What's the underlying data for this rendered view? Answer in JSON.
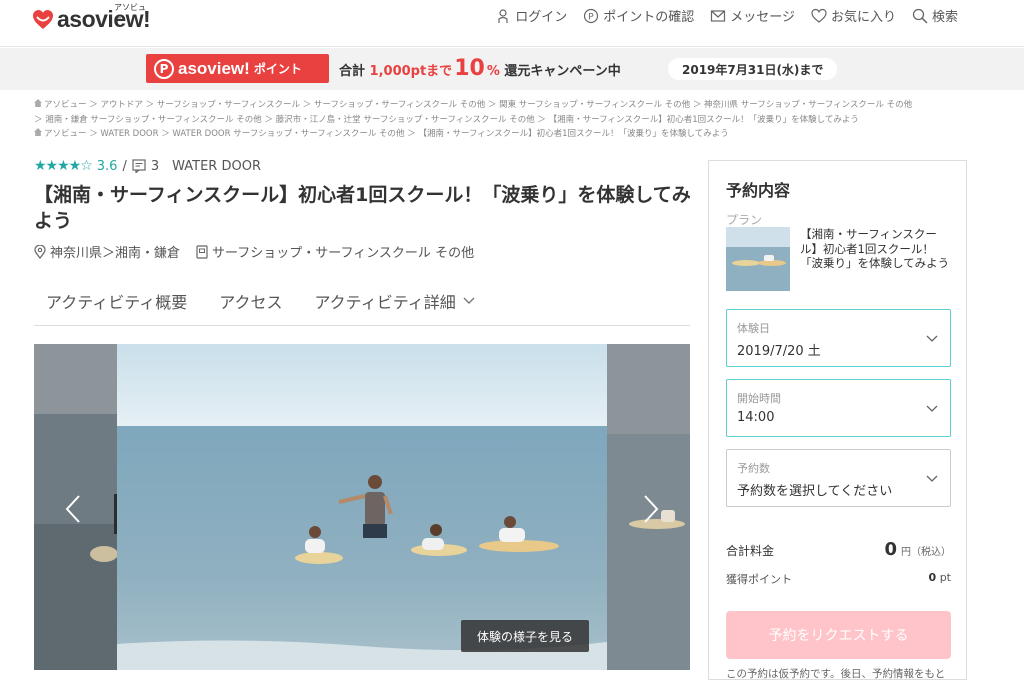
{
  "header": {
    "logo_text": "asoview!",
    "logo_kana": "アソビュー",
    "nav": [
      {
        "label": "ログイン",
        "icon": "person-icon"
      },
      {
        "label": "ポイントの確認",
        "icon": "point-icon"
      },
      {
        "label": "メッセージ",
        "icon": "mail-icon"
      },
      {
        "label": "お気に入り",
        "icon": "heart-icon"
      },
      {
        "label": "検索",
        "icon": "search-icon"
      }
    ]
  },
  "banner": {
    "badge_brand": "asoview!",
    "badge_label": "ポイント",
    "badge_p": "P",
    "prefix": "合計",
    "points": "1,000ptまで",
    "percent": "10",
    "percent_unit": "%",
    "suffix": "還元キャンペーン中",
    "date": "2019年7月31日(水)まで"
  },
  "breadcrumbs": {
    "line1": "アソビュー ＞ アウトドア ＞ サーフショップ・サーフィンスクール ＞ サーフショップ・サーフィンスクール その他 ＞ 関東 サーフショップ・サーフィンスクール その他 ＞ 神奈川県 サーフショップ・サーフィンスクール その他",
    "line2": "＞ 湘南・鎌倉 サーフショップ・サーフィンスクール その他 ＞ 藤沢市・江ノ島・辻堂 サーフショップ・サーフィンスクール その他 ＞ 【湘南・サーフィンスクール】初心者1回スクール！「波乗り」を体験してみよう",
    "line3": "アソビュー ＞ WATER DOOR ＞ WATER DOOR サーフショップ・サーフィンスクール その他 ＞ 【湘南・サーフィンスクール】初心者1回スクール！「波乗り」を体験してみよう"
  },
  "activity": {
    "stars": "★★★★☆",
    "rating": "3.6",
    "rating_sep": "/",
    "review_count": "3",
    "provider": "WATER DOOR",
    "title": "【湘南・サーフィンスクール】初心者1回スクール！「波乗り」を体験してみよう",
    "location": "神奈川県＞湘南・鎌倉",
    "category": "サーフショップ・サーフィンスクール その他"
  },
  "tabs": [
    "アクティビティ概要",
    "アクセス",
    "アクティビティ詳細"
  ],
  "gallery": {
    "view_button": "体験の様子を見る"
  },
  "reservation": {
    "title": "予約内容",
    "plan_label": "プラン",
    "plan_name": "【湘南・サーフィンスクール】初心者1回スクール！「波乗り」を体験してみよう",
    "date_label": "体験日",
    "date_value": "2019/7/20 土",
    "time_label": "開始時間",
    "time_value": "14:00",
    "count_label": "予約数",
    "count_value": "予約数を選択してください",
    "total_label": "合計料金",
    "total_value": "0",
    "total_unit": "円（税込）",
    "points_label": "獲得ポイント",
    "points_value": "0",
    "points_unit": "pt",
    "submit_label": "予約をリクエストする",
    "note": "この予約は仮予約です。後日、予約情報をもと"
  },
  "colors": {
    "brand_red": "#e8413f",
    "teal": "#22a8a3",
    "field_active": "#5bcfd2",
    "submit_disabled": "#ffc4c9"
  }
}
